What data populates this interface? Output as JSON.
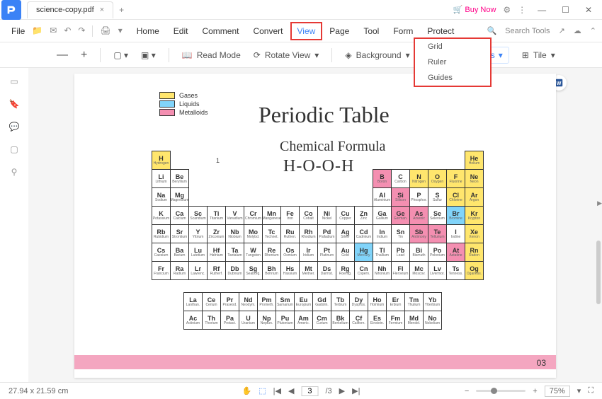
{
  "titlebar": {
    "tab_title": "science-copy.pdf",
    "buy_now": "Buy Now"
  },
  "menu": {
    "file": "File",
    "items": [
      "Home",
      "Edit",
      "Comment",
      "Convert",
      "View",
      "Page",
      "Tool",
      "Form",
      "Protect"
    ],
    "active_index": 4,
    "search_placeholder": "Search Tools"
  },
  "toolbar": {
    "read_mode": "Read Mode",
    "rotate_view": "Rotate View",
    "background": "Background",
    "rulers_grids": "Rulers & Grids",
    "tile": "Tile"
  },
  "dropdown": {
    "items": [
      "Grid",
      "Ruler",
      "Guides"
    ]
  },
  "document": {
    "title": "Periodic Table",
    "subtitle": "Chemical Formula",
    "formula": "H-O-O-H",
    "legend": {
      "gases": "Gases",
      "liquids": "Liquids",
      "metalloids": "Metalloids"
    },
    "page_number": "03",
    "page_marker": "1"
  },
  "chart_data": {
    "type": "table",
    "title": "Periodic Table",
    "legend_colors": {
      "Gases": "#ffe66d",
      "Liquids": "#81d4fa",
      "Metalloids": "#f48fb1"
    },
    "rows": [
      [
        [
          "H",
          "Hydrogen",
          "yellow"
        ],
        null,
        null,
        null,
        null,
        null,
        null,
        null,
        null,
        null,
        null,
        null,
        null,
        null,
        null,
        null,
        null,
        [
          "He",
          "Helium",
          "yellow"
        ]
      ],
      [
        [
          "Li",
          "Lithium",
          ""
        ],
        [
          "Be",
          "Beryllium",
          ""
        ],
        null,
        null,
        null,
        null,
        null,
        null,
        null,
        null,
        null,
        null,
        [
          "B",
          "Boron",
          "pink"
        ],
        [
          "C",
          "Carbon",
          ""
        ],
        [
          "N",
          "Nitrogen",
          "yellow"
        ],
        [
          "O",
          "Oxygen",
          "yellow"
        ],
        [
          "F",
          "Fluorine",
          "yellow"
        ],
        [
          "Ne",
          "Neon",
          "yellow"
        ]
      ],
      [
        [
          "Na",
          "Sodium",
          ""
        ],
        [
          "Mg",
          "Magnesium",
          ""
        ],
        null,
        null,
        null,
        null,
        null,
        null,
        null,
        null,
        null,
        null,
        [
          "Al",
          "Aluminium",
          ""
        ],
        [
          "Si",
          "Silicon",
          "pink"
        ],
        [
          "P",
          "Phosphor.",
          ""
        ],
        [
          "S",
          "Sulfur",
          ""
        ],
        [
          "Cl",
          "Chlorine",
          "yellow"
        ],
        [
          "Ar",
          "Argon",
          "yellow"
        ]
      ],
      [
        [
          "K",
          "Potassium",
          ""
        ],
        [
          "Ca",
          "Calcium",
          ""
        ],
        [
          "Sc",
          "Scandium",
          ""
        ],
        [
          "Ti",
          "Titanium",
          ""
        ],
        [
          "V",
          "Vanadium",
          ""
        ],
        [
          "Cr",
          "Chromium",
          ""
        ],
        [
          "Mn",
          "Manganese",
          ""
        ],
        [
          "Fe",
          "Iron",
          ""
        ],
        [
          "Co",
          "Cobalt",
          ""
        ],
        [
          "Ni",
          "Nickel",
          ""
        ],
        [
          "Cu",
          "Copper",
          ""
        ],
        [
          "Zn",
          "Zinc",
          ""
        ],
        [
          "Ga",
          "Gallium",
          ""
        ],
        [
          "Ge",
          "German.",
          "pink"
        ],
        [
          "As",
          "Arsenic",
          "pink"
        ],
        [
          "Se",
          "Selenium",
          ""
        ],
        [
          "Br",
          "Bromine",
          "blue"
        ],
        [
          "Kr",
          "Krypton",
          "yellow"
        ]
      ],
      [
        [
          "Rb",
          "Rubidium",
          ""
        ],
        [
          "Sr",
          "Strontium",
          ""
        ],
        [
          "Y",
          "Yttrium",
          ""
        ],
        [
          "Zr",
          "Zirconium",
          ""
        ],
        [
          "Nb",
          "Niobium",
          ""
        ],
        [
          "Mo",
          "Molybd.",
          ""
        ],
        [
          "Tc",
          "Technet.",
          ""
        ],
        [
          "Ru",
          "Ruthen.",
          ""
        ],
        [
          "Rh",
          "Rhodium",
          ""
        ],
        [
          "Pd",
          "Palladium",
          ""
        ],
        [
          "Ag",
          "Silver",
          ""
        ],
        [
          "Cd",
          "Cadmium",
          ""
        ],
        [
          "In",
          "Indium",
          ""
        ],
        [
          "Sn",
          "Tin",
          ""
        ],
        [
          "Sb",
          "Antimony",
          "pink"
        ],
        [
          "Te",
          "Tellurium",
          "pink"
        ],
        [
          "I",
          "Iodine",
          ""
        ],
        [
          "Xe",
          "Xenon",
          "yellow"
        ]
      ],
      [
        [
          "Cs",
          "Caesium",
          ""
        ],
        [
          "Ba",
          "Barium",
          ""
        ],
        [
          "Lu",
          "Lutetium",
          ""
        ],
        [
          "Hf",
          "Hafnium",
          ""
        ],
        [
          "Ta",
          "Tantalum",
          ""
        ],
        [
          "W",
          "Tungsten",
          ""
        ],
        [
          "Re",
          "Rhenium",
          ""
        ],
        [
          "Os",
          "Osmium",
          ""
        ],
        [
          "Ir",
          "Iridium",
          ""
        ],
        [
          "Pt",
          "Platinum",
          ""
        ],
        [
          "Au",
          "Gold",
          ""
        ],
        [
          "Hg",
          "Mercury",
          "blue"
        ],
        [
          "Tl",
          "Thallium",
          ""
        ],
        [
          "Pb",
          "Lead",
          ""
        ],
        [
          "Bi",
          "Bismuth",
          ""
        ],
        [
          "Po",
          "Polonium",
          ""
        ],
        [
          "At",
          "Astatine",
          "pink"
        ],
        [
          "Rn",
          "Radon",
          "yellow"
        ]
      ],
      [
        [
          "Fr",
          "Francium",
          ""
        ],
        [
          "Ra",
          "Radium",
          ""
        ],
        [
          "Lr",
          "Lawrenc.",
          ""
        ],
        [
          "Rf",
          "Rutherf.",
          ""
        ],
        [
          "Db",
          "Dubnium",
          ""
        ],
        [
          "Sg",
          "Seaborg.",
          ""
        ],
        [
          "Bh",
          "Bohrium",
          ""
        ],
        [
          "Hs",
          "Hassium",
          ""
        ],
        [
          "Mt",
          "Meitner.",
          ""
        ],
        [
          "Ds",
          "Darmst.",
          ""
        ],
        [
          "Rg",
          "Roentg.",
          ""
        ],
        [
          "Cn",
          "Copern.",
          ""
        ],
        [
          "Nh",
          "Nihonium",
          ""
        ],
        [
          "Fl",
          "Flerovium",
          ""
        ],
        [
          "Mc",
          "Moscov.",
          ""
        ],
        [
          "Lv",
          "Livermor.",
          ""
        ],
        [
          "Ts",
          "Tenness.",
          ""
        ],
        [
          "Og",
          "Oganess.",
          "yellow"
        ]
      ]
    ],
    "lanth": [
      [
        [
          "La",
          "Lanthan.",
          ""
        ],
        [
          "Ce",
          "Cerium",
          ""
        ],
        [
          "Pr",
          "Praseod.",
          ""
        ],
        [
          "Nd",
          "Neodym.",
          ""
        ],
        [
          "Pm",
          "Prometh.",
          ""
        ],
        [
          "Sm",
          "Samarium",
          ""
        ],
        [
          "Eu",
          "Europium",
          ""
        ],
        [
          "Gd",
          "Gadolin.",
          ""
        ],
        [
          "Tb",
          "Terbium",
          ""
        ],
        [
          "Dy",
          "Dyspros.",
          ""
        ],
        [
          "Ho",
          "Holmium",
          ""
        ],
        [
          "Er",
          "Erbium",
          ""
        ],
        [
          "Tm",
          "Thulium",
          ""
        ],
        [
          "Yb",
          "Ytterbium",
          ""
        ]
      ],
      [
        [
          "Ac",
          "Actinium",
          ""
        ],
        [
          "Th",
          "Thorium",
          ""
        ],
        [
          "Pa",
          "Protact.",
          ""
        ],
        [
          "U",
          "Uranium",
          ""
        ],
        [
          "Np",
          "Neptun.",
          ""
        ],
        [
          "Pu",
          "Plutonium",
          ""
        ],
        [
          "Am",
          "Americ.",
          ""
        ],
        [
          "Cm",
          "Curium",
          ""
        ],
        [
          "Bk",
          "Berkelium",
          ""
        ],
        [
          "Cf",
          "Californ.",
          ""
        ],
        [
          "Es",
          "Einstein.",
          ""
        ],
        [
          "Fm",
          "Fermium",
          ""
        ],
        [
          "Md",
          "Mendel.",
          ""
        ],
        [
          "No",
          "Nobelium",
          ""
        ]
      ]
    ]
  },
  "status": {
    "dimensions": "27.94 x 21.59 cm",
    "page_current": "3",
    "page_total": "/3",
    "zoom": "75%"
  }
}
